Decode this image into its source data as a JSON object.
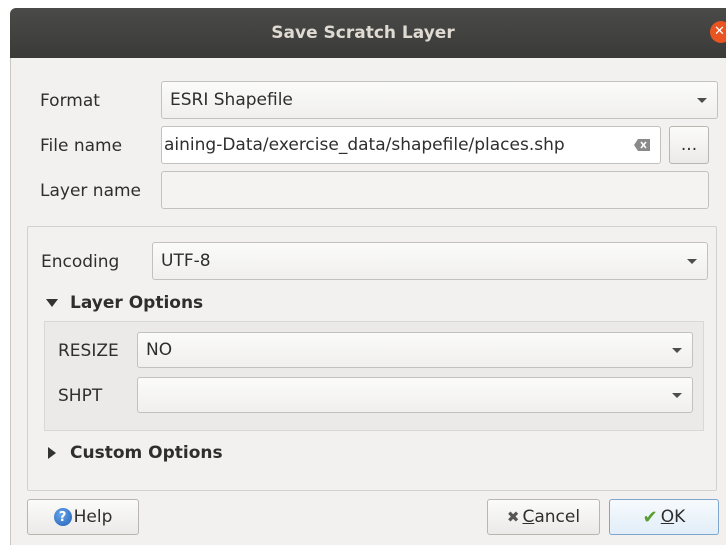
{
  "window": {
    "title": "Save Scratch Layer"
  },
  "form": {
    "format_label": "Format",
    "format_value": "ESRI Shapefile",
    "filename_label": "File name",
    "filename_value": "aining-Data/exercise_data/shapefile/places.shp",
    "browse_label": "...",
    "layername_label": "Layer name",
    "layername_value": ""
  },
  "encoding": {
    "label": "Encoding",
    "value": "UTF-8"
  },
  "layer_options": {
    "title": "Layer Options",
    "resize_label": "RESIZE",
    "resize_value": "NO",
    "shpt_label": "SHPT",
    "shpt_value": ""
  },
  "custom_options": {
    "title": "Custom Options"
  },
  "buttons": {
    "help": "Help",
    "cancel_prefix": "",
    "cancel_underlined": "C",
    "cancel_rest": "ancel",
    "ok_underlined": "O",
    "ok_rest": "K"
  },
  "colors": {
    "titlebar": "#3f3f3d",
    "close": "#e95420",
    "dialog_bg": "#f2f1f0"
  }
}
